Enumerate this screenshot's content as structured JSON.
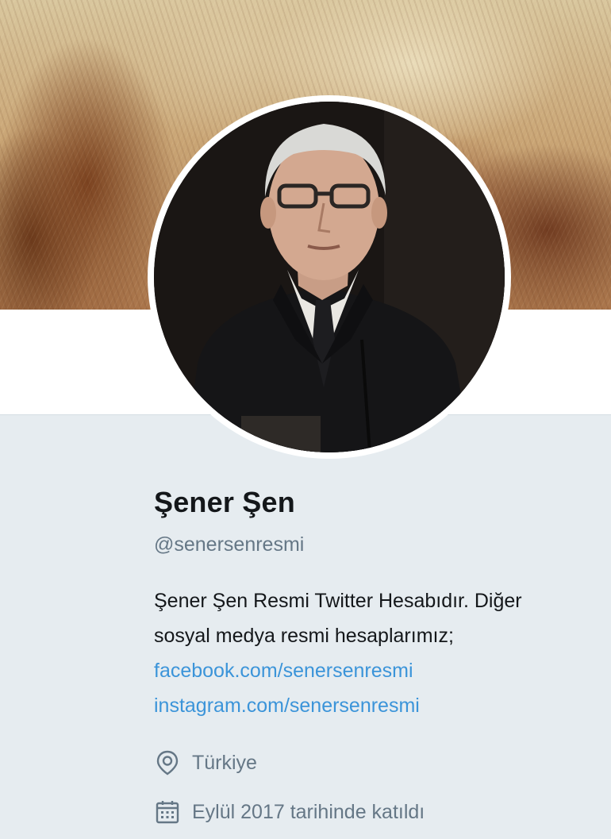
{
  "profile": {
    "name": "Şener Şen",
    "handle": "@senersenresmi",
    "bio_lines": [
      "Şener Şen Resmi Twitter Hesabıdır. Diğer",
      "sosyal medya resmi hesaplarımız;"
    ],
    "links": [
      "facebook.com/senersenresmi",
      "instagram.com/senersenresmi"
    ],
    "location": "Türkiye",
    "joined": "Eylül 2017 tarihinde katıldı"
  },
  "icons": {
    "location": "location-pin-icon",
    "joined": "calendar-icon"
  },
  "colors": {
    "link": "#3b94d9",
    "muted": "#657786",
    "text": "#14171a",
    "background": "#e6ecf0"
  }
}
